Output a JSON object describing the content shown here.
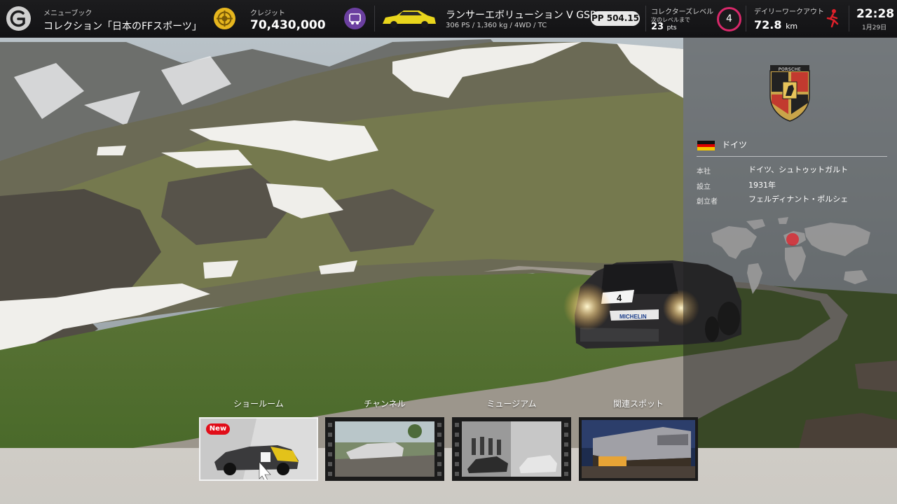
{
  "topbar": {
    "menu_book_label": "メニューブック",
    "menu_book_title": "コレクション「日本のFFスポーツ」",
    "credits_label": "クレジット",
    "credits_value": "70,430,000",
    "car_name": "ランサーエボリューション V GSR...",
    "car_specs": "306 PS / 1,360 kg / 4WD / TC",
    "pp_value": "PP 504.15",
    "collector_label": "コレクターズレベル",
    "collector_next_label": "次のレベルまで",
    "collector_pts": "23",
    "collector_pts_unit": "pts",
    "collector_level": "4",
    "workout_label": "デイリーワークアウト",
    "workout_value": "72.8",
    "workout_unit": "km",
    "clock_time": "22:28",
    "clock_date": "1月29日"
  },
  "brand_panel": {
    "brand_logo_text": "PORSCHE",
    "country": "ドイツ",
    "rows": [
      {
        "key": "本社",
        "value": "ドイツ、シュトゥットガルト"
      },
      {
        "key": "設立",
        "value": "1931年"
      },
      {
        "key": "創立者",
        "value": "フェルディナント・ポルシェ"
      }
    ]
  },
  "menu": {
    "items": [
      {
        "label": "ショールーム",
        "badge": "New"
      },
      {
        "label": "チャンネル"
      },
      {
        "label": "ミュージアム"
      },
      {
        "label": "関連スポット"
      }
    ]
  },
  "scene": {
    "car_number": "4",
    "car_sponsor": "MICHELIN"
  },
  "colors": {
    "accent_red": "#e10d18",
    "collector_ring": "#d8286a",
    "credits_icon": "#e6b61e",
    "pp_badge": "#e8e8e8"
  }
}
